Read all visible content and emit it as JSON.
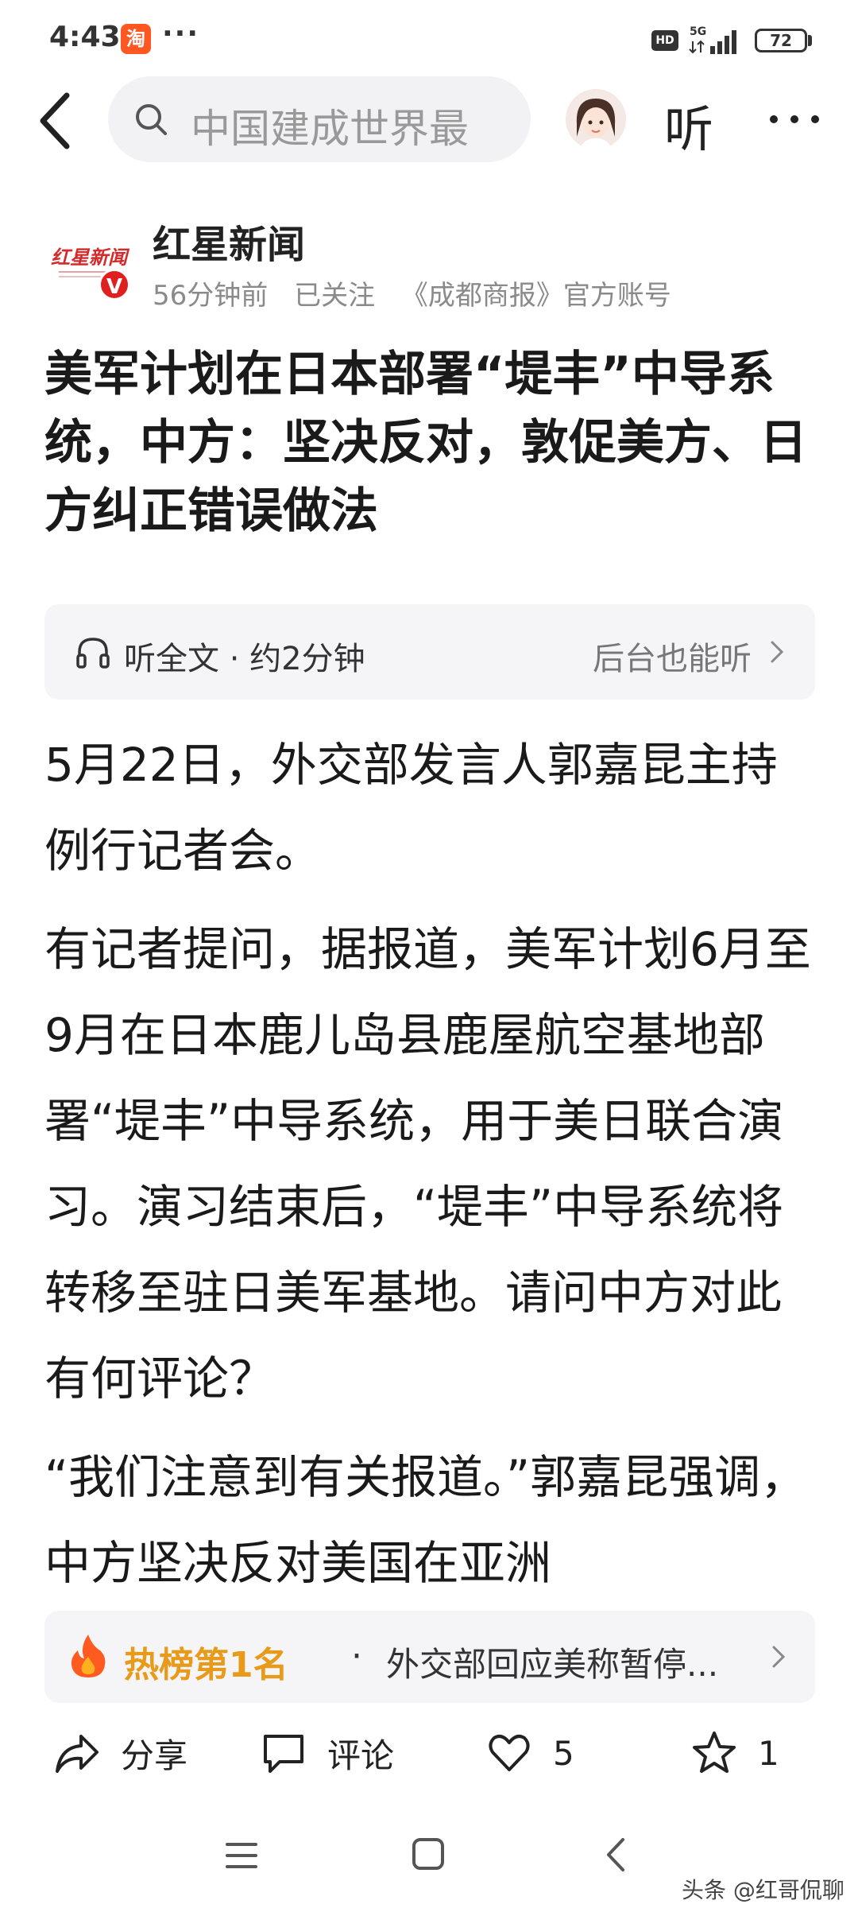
{
  "status_bar": {
    "time": "4:43",
    "app_badge": "淘",
    "more": "···",
    "hd": "HD",
    "network": "5G",
    "battery": "72"
  },
  "top_nav": {
    "search_placeholder": "中国建成世界最",
    "listen_label": "听"
  },
  "author": {
    "name": "红星新闻",
    "time": "56分钟前",
    "follow_status": "已关注",
    "description": "《成都商报》官方账号",
    "verified": "V"
  },
  "article": {
    "title": "美军计划在日本部署“堤丰”中导系统，中方：坚决反对，敦促美方、日方纠正错误做法",
    "paragraphs": [
      "5月22日，外交部发言人郭嘉昆主持例行记者会。",
      "有记者提问，据报道，美军计划6月至9月在日本鹿儿岛县鹿屋航空基地部署“堤丰”中导系统，用于美日联合演习。演习结束后，“堤丰”中导系统将转移至驻日美军基地。请问中方对此有何评论？",
      "“我们注意到有关报道。”郭嘉昆强调，中方坚决反对美国在亚洲"
    ]
  },
  "listen_bar": {
    "label": "听全文 · 约2分钟",
    "background_label": "后台也能听"
  },
  "hot_list": {
    "rank": "热榜第1名",
    "separator": "·",
    "title": "外交部回应美称暂停..."
  },
  "actions": {
    "share": "分享",
    "comment": "评论",
    "like_count": "5",
    "favorite_count": "1"
  },
  "watermark": "头条 @红哥侃聊",
  "colors": {
    "accent_red": "#e02020",
    "hot_orange": "#e89a1a",
    "panel_bg": "#f5f5f7"
  }
}
